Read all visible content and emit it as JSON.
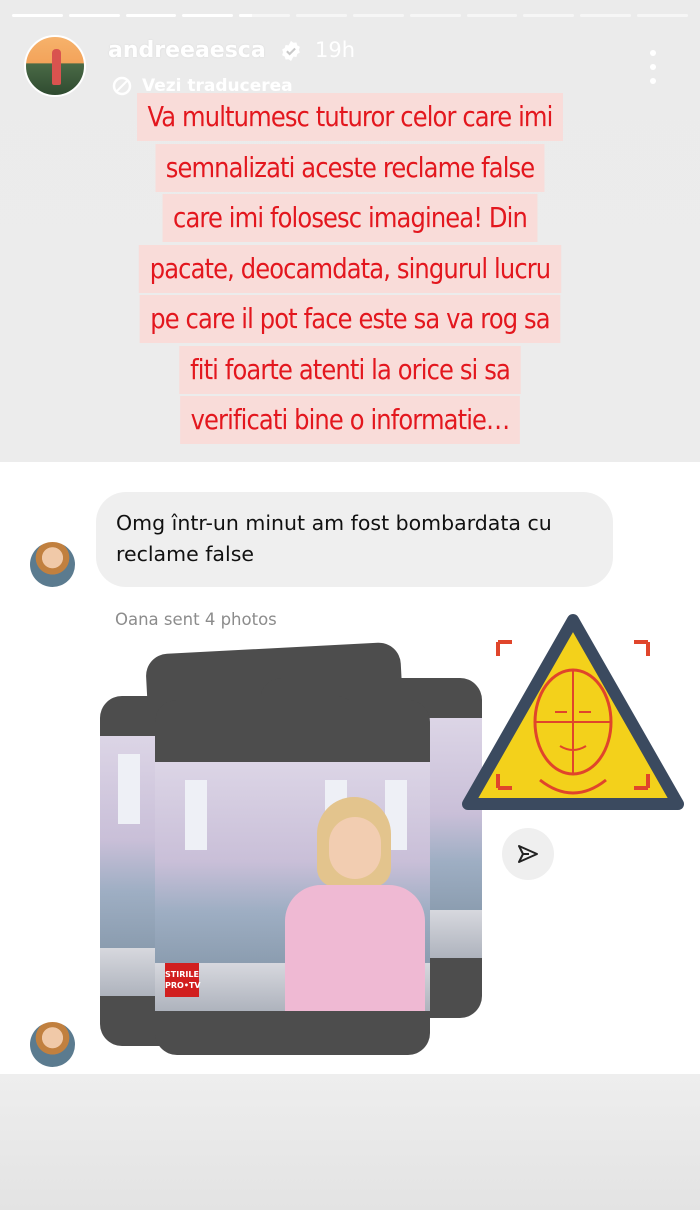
{
  "story": {
    "progress": [
      {
        "fill": 1
      },
      {
        "fill": 1
      },
      {
        "fill": 1
      },
      {
        "fill": 1
      },
      {
        "fill": 0.25
      },
      {
        "fill": 0
      },
      {
        "fill": 0
      },
      {
        "fill": 0
      },
      {
        "fill": 0
      },
      {
        "fill": 0
      },
      {
        "fill": 0
      },
      {
        "fill": 0
      }
    ],
    "username": "andreeaesca",
    "time": "19h",
    "translate_label": "Vezi traducerea",
    "caption_lines": [
      "Va multumesc tuturor celor care imi",
      "semnalizati aceste reclame false",
      "care imi folosesc imaginea! Din",
      "pacate, deocamdata, singurul lucru",
      "pe care il pot face este sa va rog sa",
      "fiti foarte atenti la orice si sa",
      "verificati bine o informatie…"
    ],
    "colors": {
      "caption_text": "#e3171e",
      "caption_bg": "#f9dcd9"
    }
  },
  "chat": {
    "message": "Omg într-un minut am fost bombardata cu reclame false",
    "sent_note": "Oana sent 4 photos",
    "photos_count": 4,
    "news_logo": [
      "STIRILE",
      "PRO•TV"
    ]
  },
  "icons": {
    "verified": "verified-badge-icon",
    "more": "more-vertical-icon",
    "translate": "translate-icon",
    "share": "send-icon",
    "warning": "face-recognition-warning-icon"
  }
}
